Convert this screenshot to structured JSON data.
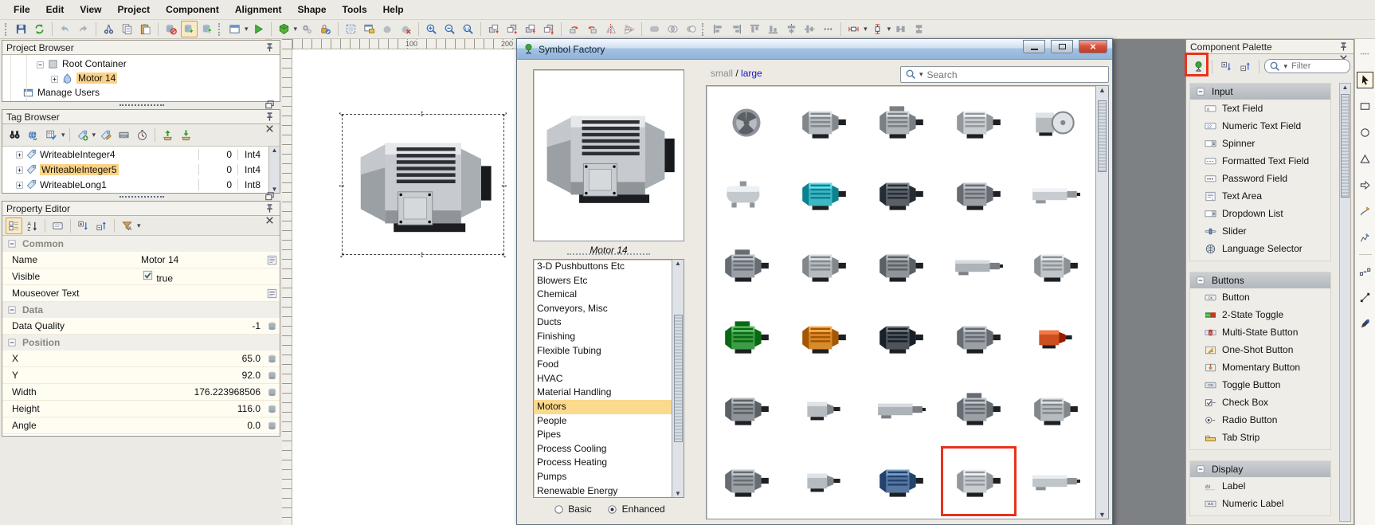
{
  "window": {
    "menu": [
      "File",
      "Edit",
      "View",
      "Project",
      "Component",
      "Alignment",
      "Shape",
      "Tools",
      "Help"
    ]
  },
  "toolbar": {
    "active_icon": "db-download",
    "groups": [
      [
        "save",
        "sync"
      ],
      [
        "undo",
        "redo"
      ],
      [
        "cut",
        "copy",
        "paste"
      ],
      [
        "db-block",
        "db-download",
        "db-upload"
      ],
      [
        "window",
        "caret",
        "play"
      ],
      [
        "cube",
        "caret",
        "gears",
        "security"
      ],
      [
        "select-all",
        "select-window",
        "shape-gray",
        "shape-delete"
      ],
      [
        "zoom-in",
        "zoom-out",
        "zoom-actual"
      ],
      [
        "order-forward",
        "order-backward",
        "order-front",
        "order-back"
      ],
      [
        "rotate-left",
        "rotate-right",
        "flip-horizontal",
        "flip-vertical"
      ],
      [
        "shape-union",
        "shape-intersect",
        "shape-subtract"
      ],
      [
        "align-left",
        "align-right",
        "align-top",
        "align-bottom",
        "center-horizontal",
        "center-vertical",
        "more"
      ],
      [
        "size-width",
        "caret",
        "size-height",
        "caret",
        "match-width",
        "match-height"
      ]
    ]
  },
  "project_browser": {
    "title": "Project Browser",
    "header_icons": [
      "float",
      "pin",
      "close"
    ],
    "items": [
      {
        "label": "Root Container",
        "icon": "container",
        "level": 2,
        "toggle": "minus-box",
        "selected": false
      },
      {
        "label": "Motor 14",
        "icon": "motor-node",
        "level": 3,
        "toggle": "plus-box",
        "selected": true
      },
      {
        "label": "Manage Users",
        "icon": "window-node",
        "level": 1,
        "toggle": "none",
        "selected": false
      }
    ]
  },
  "tag_browser": {
    "title": "Tag Browser",
    "header_icons": [
      "float",
      "pin",
      "close"
    ],
    "toolbar": [
      "binoculars",
      "globe-sync",
      "table-check",
      "caret",
      "sep",
      "tag-add",
      "caret",
      "tag-edit",
      "opc",
      "timer",
      "sep",
      "import",
      "export"
    ],
    "rows": [
      {
        "name": "WriteableInteger4",
        "value": "0",
        "type": "Int4",
        "selected": false
      },
      {
        "name": "WriteableInteger5",
        "value": "0",
        "type": "Int4",
        "selected": true
      },
      {
        "name": "WriteableLong1",
        "value": "0",
        "type": "Int8",
        "selected": false
      }
    ]
  },
  "property_editor": {
    "title": "Property Editor",
    "header_icons": [
      "float",
      "pin",
      "close"
    ],
    "toolbar": [
      "categorize",
      "sort-az",
      "sep",
      "description",
      "sep",
      "expand-all",
      "collapse-all",
      "sep",
      "filter-funnel",
      "caret"
    ],
    "active_icon": "categorize",
    "rows": [
      {
        "kind": "section",
        "label": "Common"
      },
      {
        "kind": "prop",
        "label": "Name",
        "value": "Motor 14",
        "align": "left",
        "icon": "edit",
        "checkbox": false
      },
      {
        "kind": "prop",
        "label": "Visible",
        "value": "true",
        "align": "left",
        "icon": "none",
        "checkbox": true
      },
      {
        "kind": "prop",
        "label": "Mouseover Text",
        "value": "",
        "align": "left",
        "icon": "edit",
        "checkbox": false
      },
      {
        "kind": "section",
        "label": "Data"
      },
      {
        "kind": "prop",
        "label": "Data Quality",
        "value": "-1",
        "align": "right",
        "icon": "bind",
        "checkbox": false
      },
      {
        "kind": "section",
        "label": "Position"
      },
      {
        "kind": "prop",
        "label": "X",
        "value": "65.0",
        "align": "right",
        "icon": "bind",
        "checkbox": false
      },
      {
        "kind": "prop",
        "label": "Y",
        "value": "92.0",
        "align": "right",
        "icon": "bind",
        "checkbox": false
      },
      {
        "kind": "prop",
        "label": "Width",
        "value": "176.223968506",
        "align": "right",
        "icon": "bind",
        "checkbox": false
      },
      {
        "kind": "prop",
        "label": "Height",
        "value": "116.0",
        "align": "right",
        "icon": "bind",
        "checkbox": false
      },
      {
        "kind": "prop",
        "label": "Angle",
        "value": "0.0",
        "align": "right",
        "icon": "bind",
        "checkbox": false
      }
    ]
  },
  "canvas": {
    "ruler_labels": [
      "100",
      "200"
    ],
    "selected_component": "Motor 14"
  },
  "symbol_factory": {
    "title": "Symbol Factory",
    "window_icons": [
      "minimize",
      "maximize",
      "close"
    ],
    "size_options": {
      "small": "small",
      "separator": "/",
      "large": "large",
      "selected": "large"
    },
    "search_placeholder": "Search",
    "preview_caption": "Motor 14",
    "categories": [
      "3-D Pushbuttons Etc",
      "Blowers Etc",
      "Chemical",
      "Conveyors, Misc",
      "Ducts",
      "Finishing",
      "Flexible Tubing",
      "Food",
      "HVAC",
      "Material Handling",
      "Motors",
      "People",
      "Pipes",
      "Process Cooling",
      "Process Heating",
      "Pumps",
      "Renewable Energy"
    ],
    "selected_category": "Motors",
    "mode": {
      "basic_label": "Basic",
      "enhanced_label": "Enhanced",
      "selected": "Enhanced"
    },
    "symbols": [
      {
        "v": "front",
        "c": "#8E9499",
        "selected": false
      },
      {
        "v": "side",
        "c": "#B6BBC0",
        "selected": false
      },
      {
        "v": "gear",
        "c": "#AEB3B8",
        "selected": false
      },
      {
        "v": "side",
        "c": "#C8CCD0",
        "selected": false
      },
      {
        "v": "face",
        "c": "#B6BBC0",
        "selected": false
      },
      {
        "v": "tank",
        "c": "#C4C9CD",
        "selected": false
      },
      {
        "v": "side",
        "c": "#3FB6C4",
        "selected": false
      },
      {
        "v": "side",
        "c": "#5A6068",
        "selected": false
      },
      {
        "v": "side",
        "c": "#9AA0A6",
        "selected": false
      },
      {
        "v": "long",
        "c": "#C8CCD0",
        "selected": false
      },
      {
        "v": "gear",
        "c": "#9AA0A6",
        "selected": false
      },
      {
        "v": "side",
        "c": "#B6BBC0",
        "selected": false
      },
      {
        "v": "side",
        "c": "#8E9499",
        "selected": false
      },
      {
        "v": "long",
        "c": "#AEB3B8",
        "selected": false
      },
      {
        "v": "side",
        "c": "#C0C5C9",
        "selected": false
      },
      {
        "v": "gear",
        "c": "#3D9C46",
        "selected": false
      },
      {
        "v": "side",
        "c": "#D98A2B",
        "selected": false
      },
      {
        "v": "side",
        "c": "#4E545B",
        "selected": false
      },
      {
        "v": "side",
        "c": "#9AA0A6",
        "selected": false
      },
      {
        "v": "small",
        "c": "#CC4F1E",
        "selected": false
      },
      {
        "v": "side",
        "c": "#8E9499",
        "selected": false
      },
      {
        "v": "small",
        "c": "#B6BBC0",
        "selected": false
      },
      {
        "v": "long",
        "c": "#AEB3B8",
        "selected": false
      },
      {
        "v": "gear",
        "c": "#9AA0A6",
        "selected": false
      },
      {
        "v": "side",
        "c": "#B6BBC0",
        "selected": false
      },
      {
        "v": "side",
        "c": "#9AA0A6",
        "selected": false
      },
      {
        "v": "small",
        "c": "#B6BBC0",
        "selected": false
      },
      {
        "v": "side",
        "c": "#5577A0",
        "selected": false
      },
      {
        "v": "side",
        "c": "#C8CCD0",
        "selected": true
      },
      {
        "v": "long",
        "c": "#C0C5C9",
        "selected": false
      }
    ]
  },
  "component_palette": {
    "title": "Component Palette",
    "header_icons": [
      "float",
      "pin",
      "close"
    ],
    "toolbar": [
      "symbol-factory",
      "sep",
      "expand-all",
      "collapse-all",
      "sep"
    ],
    "filter_placeholder": "Filter",
    "sections": [
      {
        "label": "Input",
        "items": [
          {
            "icon": "text-field",
            "label": "Text Field"
          },
          {
            "icon": "numeric-text-field",
            "label": "Numeric Text Field"
          },
          {
            "icon": "spinner",
            "label": "Spinner"
          },
          {
            "icon": "formatted-text-field",
            "label": "Formatted Text Field"
          },
          {
            "icon": "password-field",
            "label": "Password Field"
          },
          {
            "icon": "text-area",
            "label": "Text Area"
          },
          {
            "icon": "dropdown-list",
            "label": "Dropdown List"
          },
          {
            "icon": "slider",
            "label": "Slider"
          },
          {
            "icon": "language-selector",
            "label": "Language Selector"
          }
        ]
      },
      {
        "label": "Buttons",
        "items": [
          {
            "icon": "button",
            "label": "Button"
          },
          {
            "icon": "two-state-toggle",
            "label": "2-State Toggle"
          },
          {
            "icon": "multi-state-button",
            "label": "Multi-State Button"
          },
          {
            "icon": "one-shot-button",
            "label": "One-Shot Button"
          },
          {
            "icon": "momentary-button",
            "label": "Momentary Button"
          },
          {
            "icon": "toggle-button",
            "label": "Toggle Button"
          },
          {
            "icon": "check-box",
            "label": "Check Box"
          },
          {
            "icon": "radio-button",
            "label": "Radio Button"
          },
          {
            "icon": "tab-strip",
            "label": "Tab Strip"
          }
        ]
      },
      {
        "label": "Display",
        "items": [
          {
            "icon": "label",
            "label": "Label"
          },
          {
            "icon": "numeric-label",
            "label": "Numeric Label"
          }
        ]
      }
    ]
  },
  "drawing_toolbar": {
    "icons": [
      "dots-h",
      "cursor",
      "rect-tool",
      "circle-tool",
      "triangle-tool",
      "arrow-tool",
      "pencil-curve",
      "pencil-zigzag",
      "sep",
      "path-nodes",
      "segment",
      "pen"
    ],
    "active_icon": "cursor"
  },
  "colors": {
    "highlight": "#FBD285",
    "category_highlight": "#FBD98D",
    "annotation": "#E8321C",
    "link": "#1414C8",
    "titlebar_top": "#D7E5F4",
    "titlebar_bottom": "#8FB3D9"
  }
}
